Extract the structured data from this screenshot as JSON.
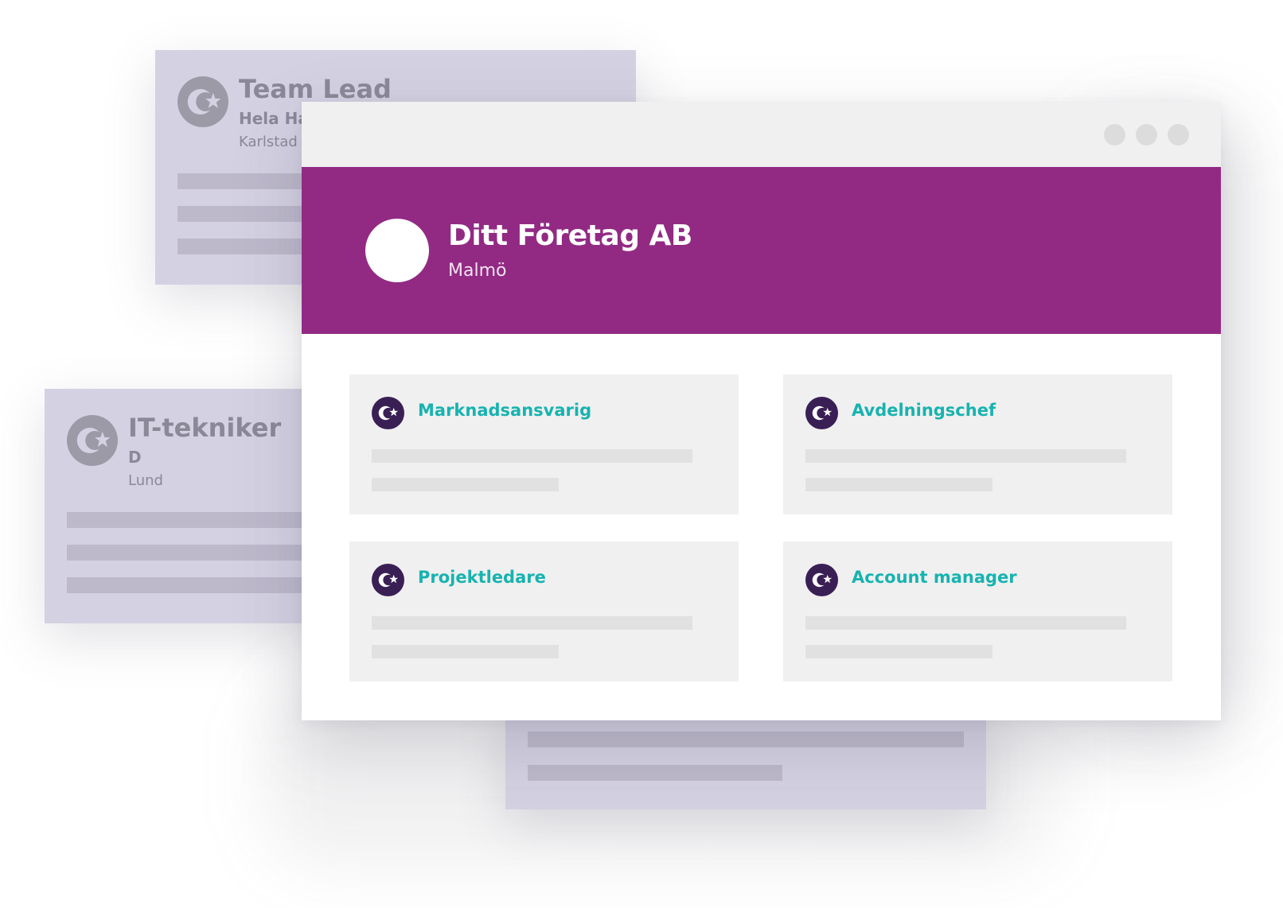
{
  "background_cards": [
    {
      "title": "Team Lead",
      "subtitle": "Hela Ha",
      "location": "Karlstad"
    },
    {
      "title": "IT-tekniker",
      "subtitle": "D",
      "location": "Lund"
    }
  ],
  "window": {
    "company": {
      "name": "Ditt Företag AB",
      "city": "Malmö"
    },
    "jobs": [
      {
        "title": "Marknadsansvarig"
      },
      {
        "title": "Avdelningschef"
      },
      {
        "title": "Projektledare"
      },
      {
        "title": "Account manager"
      }
    ]
  },
  "colors": {
    "hero": "#922a84",
    "job_title": "#17b3b0",
    "logo_dark": "#3a1f55",
    "bg_card": "#d4d1e2"
  },
  "icons": {
    "job_logo": "company-star-logo-icon",
    "window_controls": "window-dot-icon"
  }
}
